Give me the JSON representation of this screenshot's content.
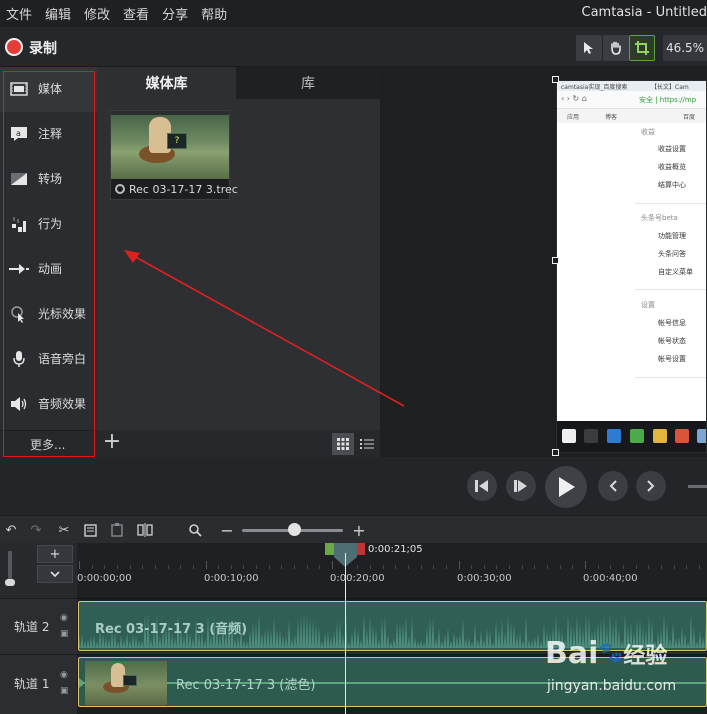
{
  "menubar": {
    "items": [
      "文件",
      "编辑",
      "修改",
      "查看",
      "分享",
      "帮助"
    ],
    "title": "Camtasia - Untitled"
  },
  "toolbar": {
    "record_label": "录制",
    "zoom_level": "46.5%",
    "tools": [
      "pointer-icon",
      "hand-icon",
      "crop-icon"
    ],
    "accent_color": "#58a43a"
  },
  "sidebar": {
    "items": [
      {
        "label": "媒体",
        "icon": "film-strip-icon"
      },
      {
        "label": "注释",
        "icon": "annotation-icon"
      },
      {
        "label": "转场",
        "icon": "transition-icon"
      },
      {
        "label": "行为",
        "icon": "behavior-icon"
      },
      {
        "label": "动画",
        "icon": "animation-icon"
      },
      {
        "label": "光标效果",
        "icon": "cursor-effect-icon"
      },
      {
        "label": "语音旁白",
        "icon": "microphone-icon"
      },
      {
        "label": "音频效果",
        "icon": "speaker-icon"
      }
    ],
    "more_label": "更多..."
  },
  "media_bin": {
    "tabs": [
      "媒体库",
      "库"
    ],
    "clip_name": "Rec 03-17-17 3.trec",
    "clip_screen_text": "?"
  },
  "canvas": {
    "browser_tabs": [
      "camtasia实现_百度搜索",
      "【长文】Cam"
    ],
    "nav_text": "安全 | https://mp",
    "bookmarks": [
      "应用",
      "博客",
      "百度"
    ],
    "sections": [
      {
        "title": "收益",
        "links": [
          "收益设置",
          "收益概览",
          "结算中心"
        ]
      },
      {
        "title": "头条号beta",
        "links": [
          "功能管理",
          "头条问答",
          "自定义菜单"
        ]
      },
      {
        "title": "设置",
        "links": [
          "帐号信息",
          "帐号状态",
          "帐号设置"
        ]
      }
    ]
  },
  "timeline": {
    "playhead_time": "0:00:21;05",
    "ruler_labels": [
      "0:00:00;00",
      "0:00:10;00",
      "0:00:20;00",
      "0:00:30;00",
      "0:00:40;00"
    ],
    "tracks": [
      {
        "label": "轨道 2",
        "clip_label": "Rec 03-17-17 3 (音频)"
      },
      {
        "label": "轨道 1",
        "clip_label": "Rec 03-17-17 3 (滤色)"
      }
    ]
  },
  "watermark": {
    "logo_text": "Bai",
    "logo_suffix": "经验",
    "url": "jingyan.baidu.com"
  }
}
